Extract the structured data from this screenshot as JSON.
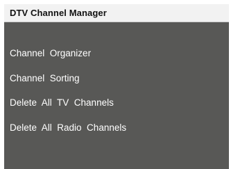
{
  "window": {
    "title": "DTV Channel Manager"
  },
  "menu": {
    "items": [
      {
        "label": "Channel  Organizer"
      },
      {
        "label": "Channel  Sorting"
      },
      {
        "label": "Delete  All  TV  Channels"
      },
      {
        "label": "Delete  All  Radio  Channels"
      }
    ]
  },
  "colors": {
    "title_bar_bg": "#f2f2f2",
    "panel_bg": "#585856",
    "menu_text": "#ffffff",
    "title_text": "#111111"
  }
}
